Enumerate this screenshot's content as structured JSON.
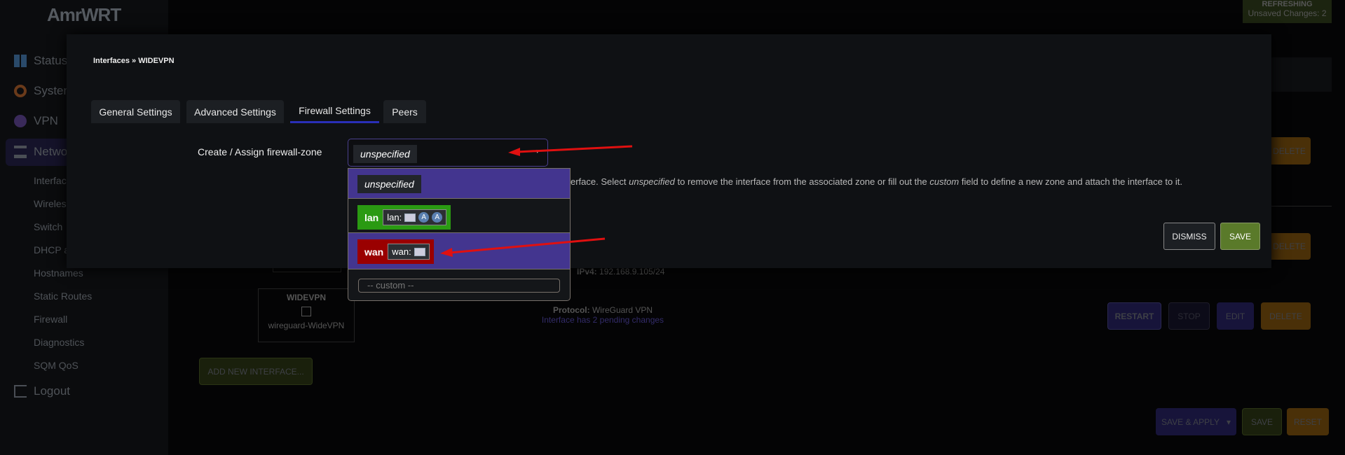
{
  "app": {
    "logo": "AmrWRT",
    "status_badge": "REFRESHING",
    "unsaved": "Unsaved Changes: 2"
  },
  "sidebar": {
    "items": [
      {
        "label": "Status",
        "icon": "dashboard-icon"
      },
      {
        "label": "System",
        "icon": "gear-icon"
      },
      {
        "label": "VPN",
        "icon": "globe-icon"
      },
      {
        "label": "Network",
        "icon": "network-icon"
      }
    ],
    "network_sub": [
      "Interfaces",
      "Wireless",
      "Switch",
      "DHCP and DNS",
      "Hostnames",
      "Static Routes",
      "Firewall",
      "Diagnostics",
      "SQM QoS"
    ],
    "logout": "Logout"
  },
  "background": {
    "delete": "DELETE",
    "ipv4_label": "IPv4:",
    "ipv4": "192.168.9.105/24",
    "widevpn": {
      "name": "WIDEVPN",
      "device": "wireguard-WideVPN",
      "protocol_label": "Protocol:",
      "protocol": "WireGuard VPN",
      "pending": "Interface has 2 pending changes"
    },
    "row_buttons": {
      "restart": "RESTART",
      "stop": "STOP",
      "edit": "EDIT",
      "delete": "DELETE"
    },
    "add_interface": "ADD NEW INTERFACE...",
    "footer": {
      "save_apply": "SAVE & APPLY",
      "save": "SAVE",
      "reset": "RESET"
    }
  },
  "modal": {
    "breadcrumb": "Interfaces » WIDEVPN",
    "tabs": [
      "General Settings",
      "Advanced Settings",
      "Firewall Settings",
      "Peers"
    ],
    "active_tab": "Firewall Settings",
    "field_label": "Create / Assign firewall-zone",
    "selected": "unspecified",
    "options": {
      "unspecified": "unspecified",
      "lan": {
        "zone": "lan",
        "devices": "lan:"
      },
      "wan": {
        "zone": "wan",
        "devices": "wan:"
      },
      "custom_placeholder": "-- custom --"
    },
    "description": {
      "a": "erface. Select ",
      "em1": "unspecified",
      "b": " to remove the interface from the associated zone or fill out the ",
      "em2": "custom",
      "c": " field to define a new zone and attach the interface to it."
    },
    "dismiss": "DISMISS",
    "save": "SAVE"
  },
  "colors": {
    "lan": "#2a9a12",
    "wan": "#9a0000",
    "highlight": "#43358f",
    "accent": "#2a2fb8",
    "save": "#5a7a2a",
    "arrow": "#e01010"
  }
}
